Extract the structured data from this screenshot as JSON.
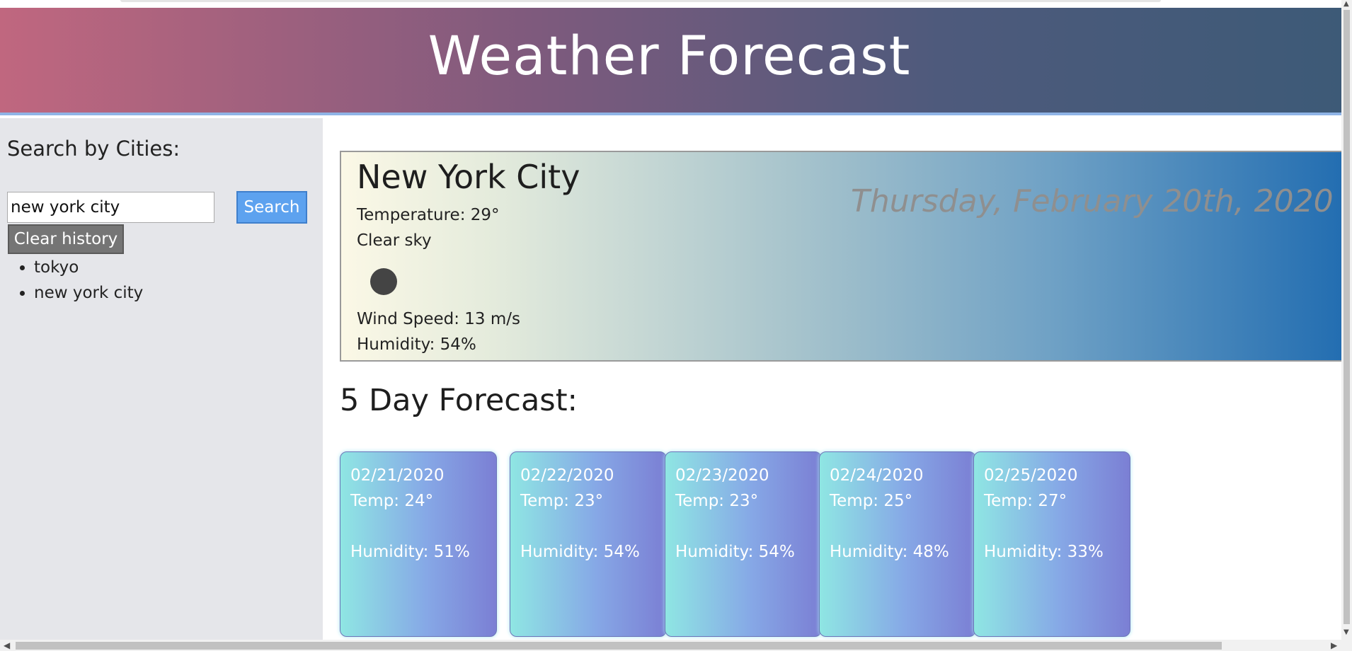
{
  "header": {
    "title": "Weather Forecast"
  },
  "sidebar": {
    "heading": "Search by Cities:",
    "search_value": "new york city",
    "search_label": "Search",
    "clear_label": "Clear history",
    "history": [
      "tokyo",
      "new york city"
    ]
  },
  "current": {
    "city": "New York City",
    "date": "Thursday, February 20th, 2020",
    "temperature": "Temperature: 29°",
    "description": "Clear sky",
    "icon": "clear-sky-icon",
    "wind": "Wind Speed: 13 m/s",
    "humidity": "Humidity: 54%"
  },
  "forecast": {
    "heading": "5 Day Forecast:",
    "days": [
      {
        "date": "02/21/2020",
        "temp": "Temp: 24°",
        "humidity": "Humidity: 51%"
      },
      {
        "date": "02/22/2020",
        "temp": "Temp: 23°",
        "humidity": "Humidity: 54%"
      },
      {
        "date": "02/23/2020",
        "temp": "Temp: 23°",
        "humidity": "Humidity: 54%"
      },
      {
        "date": "02/24/2020",
        "temp": "Temp: 25°",
        "humidity": "Humidity: 48%"
      },
      {
        "date": "02/25/2020",
        "temp": "Temp: 27°",
        "humidity": "Humidity: 33%"
      }
    ]
  },
  "colors": {
    "header_start": "#c0677f",
    "header_end": "#3d5a77",
    "search_button": "#5da2ef",
    "clear_button": "#757575",
    "sidebar_bg": "#e5e6ea"
  }
}
